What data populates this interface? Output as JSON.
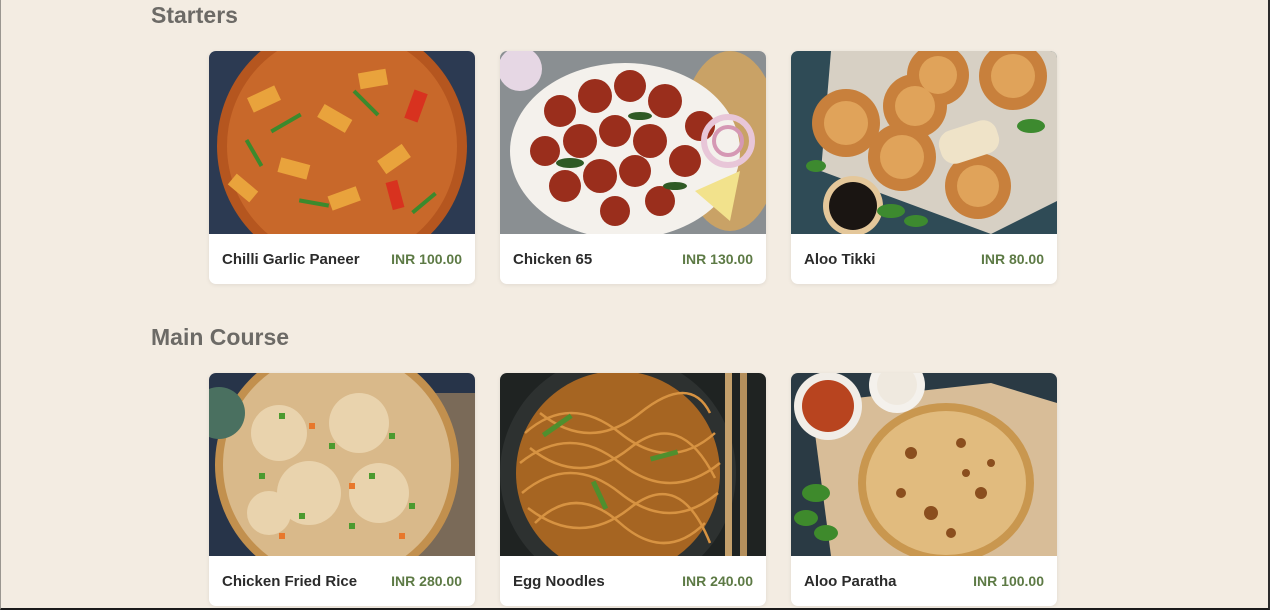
{
  "sections": [
    {
      "title": "Starters",
      "items": [
        {
          "name": "Chilli Garlic Paneer",
          "price": "INR 100.00"
        },
        {
          "name": "Chicken 65",
          "price": "INR 130.00"
        },
        {
          "name": "Aloo Tikki",
          "price": "INR 80.00"
        }
      ]
    },
    {
      "title": "Main Course",
      "items": [
        {
          "name": "Chicken Fried Rice",
          "price": "INR 280.00"
        },
        {
          "name": "Egg Noodles",
          "price": "INR 240.00"
        },
        {
          "name": "Aloo Paratha",
          "price": "INR 100.00"
        }
      ]
    }
  ],
  "colors": {
    "page_background": "#f3ece2",
    "section_title": "#6c6a66",
    "item_name": "#2b2b2b",
    "price": "#5d7a45"
  }
}
